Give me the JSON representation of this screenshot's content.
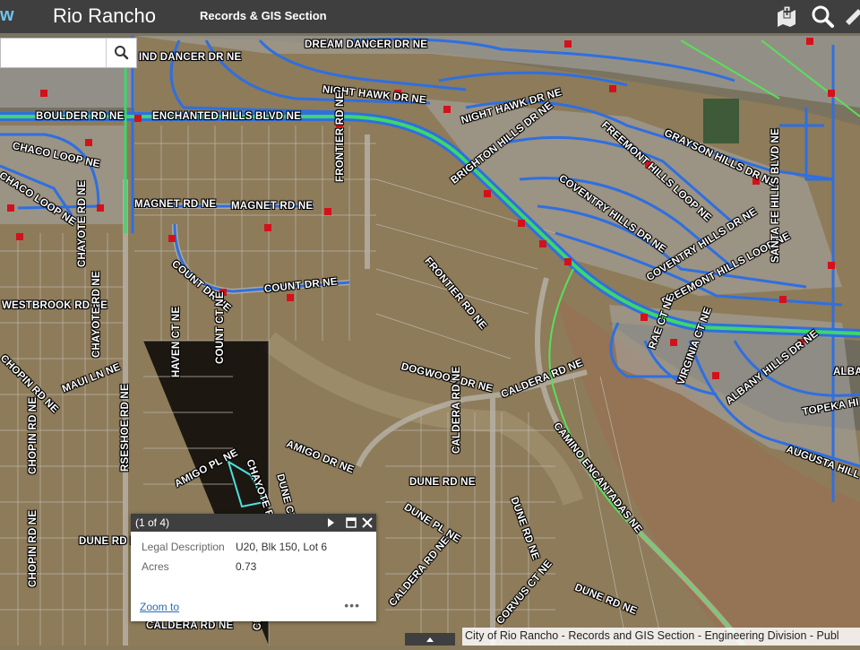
{
  "header": {
    "logo_fragment": "w",
    "title": "Rio Rancho",
    "subtitle": "Records & GIS Section",
    "icons": [
      "bookmark-add-icon",
      "search-icon",
      "measure-icon"
    ]
  },
  "search": {
    "placeholder": "",
    "value": ""
  },
  "map": {
    "labels": [
      {
        "text": "DREAM DANCER DR NE"
      },
      {
        "text": "IND DANCER DR NE"
      },
      {
        "text": "NIGHT HAWK DR NE"
      },
      {
        "text": "NIGHT HAWK DR NE"
      },
      {
        "text": "BOULDER RD NE"
      },
      {
        "text": "ENCHANTED HILLS BLVD NE"
      },
      {
        "text": "CHACO LOOP NE"
      },
      {
        "text": "CHACO LOOP NE"
      },
      {
        "text": "FREEMONT HILLS LOOP NE"
      },
      {
        "text": "GRAYSON HILLS DR NE"
      },
      {
        "text": "BRIGHTON HILLS DR NE"
      },
      {
        "text": "FRONTIER RD NE"
      },
      {
        "text": "COVENTRY HILLS DR NE"
      },
      {
        "text": "MAGNET RD NE"
      },
      {
        "text": "MAGNET RD NE"
      },
      {
        "text": "CHAYOTE RD NE"
      },
      {
        "text": "COVENTRY HILLS DR NE"
      },
      {
        "text": "FREEMONT HILLS LOOP NE"
      },
      {
        "text": "SANTA FE HILLS BLVD NE"
      },
      {
        "text": "COUNT DR NE"
      },
      {
        "text": "COUNT DR NE"
      },
      {
        "text": "FRONTIER RD NE"
      },
      {
        "text": "WESTBROOK RD NE"
      },
      {
        "text": "COUNT CT NE"
      },
      {
        "text": "RAE CT NE"
      },
      {
        "text": "CHOPIN RD NE"
      },
      {
        "text": "CHAYOTE RD NE"
      },
      {
        "text": "HAVEN CT NE"
      },
      {
        "text": "MAUI LN NE"
      },
      {
        "text": "DOGWOOD DR NE"
      },
      {
        "text": "CALDERA RD NE"
      },
      {
        "text": "VIRGINIA CT NE"
      },
      {
        "text": "ALBANY HILLS DR NE"
      },
      {
        "text": "ALBA"
      },
      {
        "text": "TOPEKA HI"
      },
      {
        "text": "CHOPIN RD NE"
      },
      {
        "text": "RSESHOE RD NE"
      },
      {
        "text": "AMIGO DR NE"
      },
      {
        "text": "CALDERA RD NE"
      },
      {
        "text": "CAMINO ENCANTADAS NE"
      },
      {
        "text": "AUGUSTA HILL"
      },
      {
        "text": "AMIGO PL NE"
      },
      {
        "text": "CHAYOTE RD NE"
      },
      {
        "text": "DUNE CT NE"
      },
      {
        "text": "DUNE RD NE"
      },
      {
        "text": "DUNE PL NE"
      },
      {
        "text": "DUNE RD NE"
      },
      {
        "text": "DUNE RD NE"
      },
      {
        "text": "CHOPIN RD NE"
      },
      {
        "text": "CALDERA RD NE"
      },
      {
        "text": "CORVUS CT NE"
      },
      {
        "text": "DUNE RD NE"
      },
      {
        "text": "CALDERA RD NE"
      },
      {
        "text": "CHA"
      }
    ]
  },
  "popup": {
    "count": "(1 of 4)",
    "fields": [
      {
        "label": "Legal Description",
        "value": "U20, Blk 150, Lot 6"
      },
      {
        "label": "Acres",
        "value": "0.73"
      }
    ],
    "zoom_label": "Zoom to",
    "more_label": "•••"
  },
  "attribution": "City of Rio Rancho - Records and GIS Section - Engineering Division - Publ",
  "colors": {
    "header": "#3f3f3f",
    "water_line": "#2f6fe0",
    "main_line": "#3ed66a",
    "hydrant": "#d4111a"
  }
}
